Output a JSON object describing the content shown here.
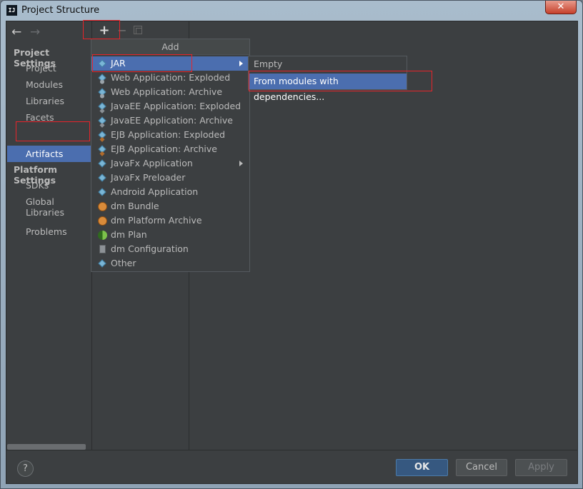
{
  "window": {
    "title": "Project Structure",
    "app_icon_text": "IJ",
    "close_symbol": "✕"
  },
  "toolbar": {
    "back_symbol": "←",
    "forward_symbol": "→",
    "add_symbol": "+",
    "remove_symbol": "−"
  },
  "sidebar": {
    "project_settings_header": "Project Settings",
    "project_items": [
      "Project",
      "Modules",
      "Libraries",
      "Facets",
      "Artifacts"
    ],
    "selected_item": "Artifacts",
    "platform_settings_header": "Platform Settings",
    "platform_items": [
      "SDKs",
      "Global Libraries"
    ],
    "problems": "Problems"
  },
  "add_menu": {
    "title": "Add",
    "items": [
      {
        "label": "JAR",
        "icon": "jar-icon",
        "submenu": true,
        "selected": true
      },
      {
        "label": "Web Application: Exploded",
        "icon": "web-app-icon"
      },
      {
        "label": "Web Application: Archive",
        "icon": "web-app-icon"
      },
      {
        "label": "JavaEE Application: Exploded",
        "icon": "javaee-app-icon"
      },
      {
        "label": "JavaEE Application: Archive",
        "icon": "javaee-app-icon"
      },
      {
        "label": "EJB Application: Exploded",
        "icon": "ejb-app-icon"
      },
      {
        "label": "EJB Application: Archive",
        "icon": "ejb-app-icon"
      },
      {
        "label": "JavaFx Application",
        "icon": "javafx-icon",
        "submenu": true
      },
      {
        "label": "JavaFx Preloader",
        "icon": "javafx-icon"
      },
      {
        "label": "Android Application",
        "icon": "android-icon"
      },
      {
        "label": "dm Bundle",
        "icon": "dm-bundle-icon"
      },
      {
        "label": "dm Platform Archive",
        "icon": "dm-platform-archive-icon"
      },
      {
        "label": "dm Plan",
        "icon": "dm-plan-icon"
      },
      {
        "label": "dm Configuration",
        "icon": "dm-configuration-icon"
      },
      {
        "label": "Other",
        "icon": "other-icon"
      }
    ]
  },
  "jar_submenu": {
    "items": [
      {
        "label": "Empty",
        "selected": false
      },
      {
        "label": "From modules with dependencies...",
        "selected": true
      }
    ]
  },
  "footer": {
    "help_symbol": "?",
    "ok_label": "OK",
    "cancel_label": "Cancel",
    "apply_label": "Apply"
  },
  "colors": {
    "selection": "#4b6eaf",
    "panel_bg": "#3c3f41",
    "annotation_red": "#e8242a"
  }
}
